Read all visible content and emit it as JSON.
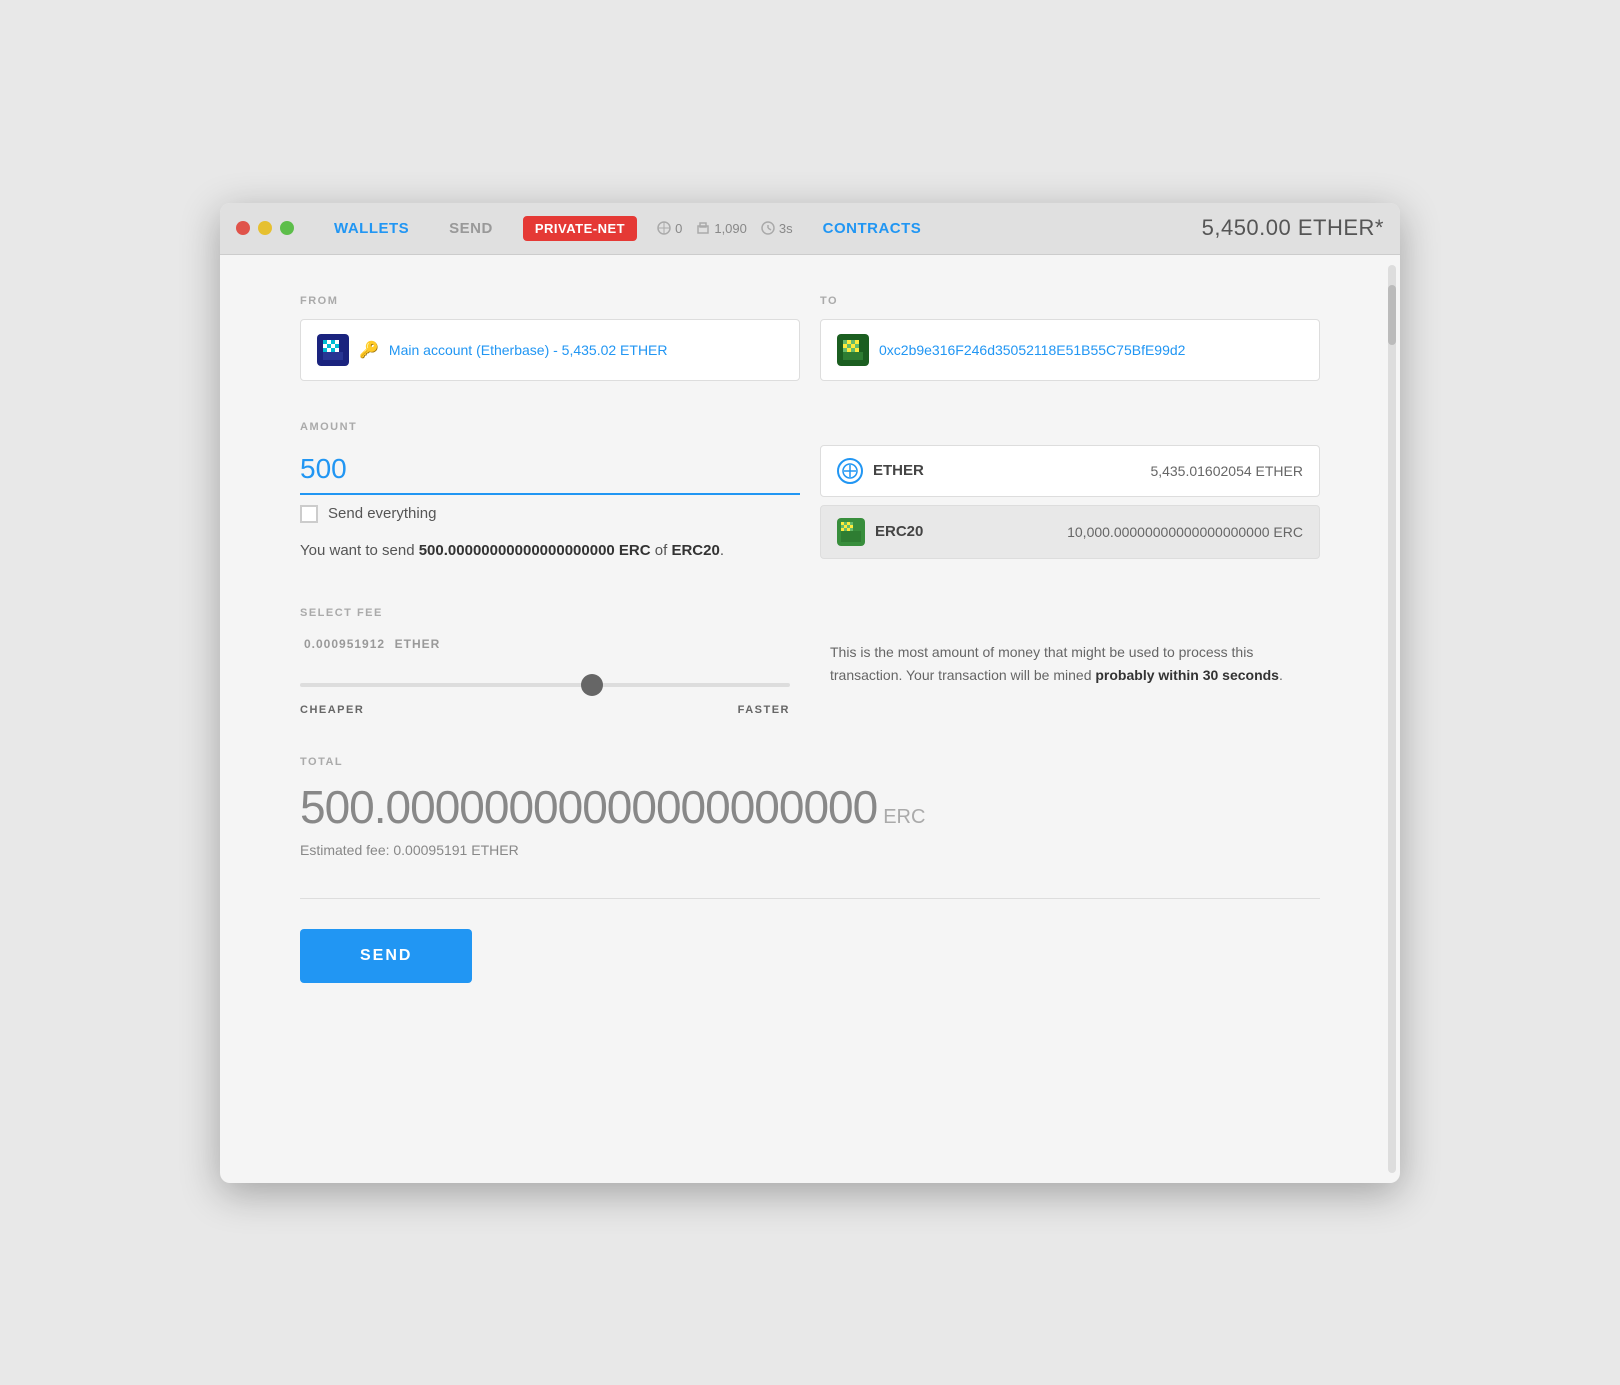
{
  "titlebar": {
    "wallets_label": "WALLETS",
    "send_label": "SEND",
    "private_net_label": "PRIVATE-NET",
    "status_peers": "0",
    "status_blocks": "1,090",
    "status_time": "3s",
    "contracts_label": "CONTRACTS",
    "balance": "5,450.00",
    "balance_unit": "ETHER*"
  },
  "from": {
    "label": "FROM",
    "icon_alt": "account-icon",
    "key_icon": "🔑",
    "name": "Main account (Etherbase) - 5,435.02 ETHER"
  },
  "to": {
    "label": "TO",
    "icon_alt": "to-account-icon",
    "address": "0xc2b9e316F246d35052118E51B55C75BfE99d2"
  },
  "amount": {
    "label": "AMOUNT",
    "value": "500",
    "send_everything_label": "Send everything"
  },
  "currencies": [
    {
      "name": "ETHER",
      "balance": "5,435.01602054 ETHER",
      "selected": false
    },
    {
      "name": "ERC20",
      "balance": "10,000.00000000000000000000 ERC",
      "selected": true
    }
  ],
  "send_info": {
    "text_prefix": "You want to send ",
    "amount_bold": "500.00000000000000000000 ERC",
    "text_mid": " of ",
    "token_bold": "ERC20",
    "text_suffix": "."
  },
  "fee": {
    "label": "SELECT FEE",
    "amount": "0.000951912",
    "unit": "ETHER",
    "slider_value": 60,
    "cheaper_label": "CHEAPER",
    "faster_label": "FASTER",
    "info_text_prefix": "This is the most amount of money that might be used to process this transaction. Your transaction will be mined ",
    "info_bold": "probably within 30 seconds",
    "info_suffix": "."
  },
  "total": {
    "label": "TOTAL",
    "amount": "500.00000000000000000000",
    "unit": "ERC",
    "estimated_fee_label": "Estimated fee: 0.00095191 ETHER"
  },
  "send_button": {
    "label": "SEND"
  }
}
